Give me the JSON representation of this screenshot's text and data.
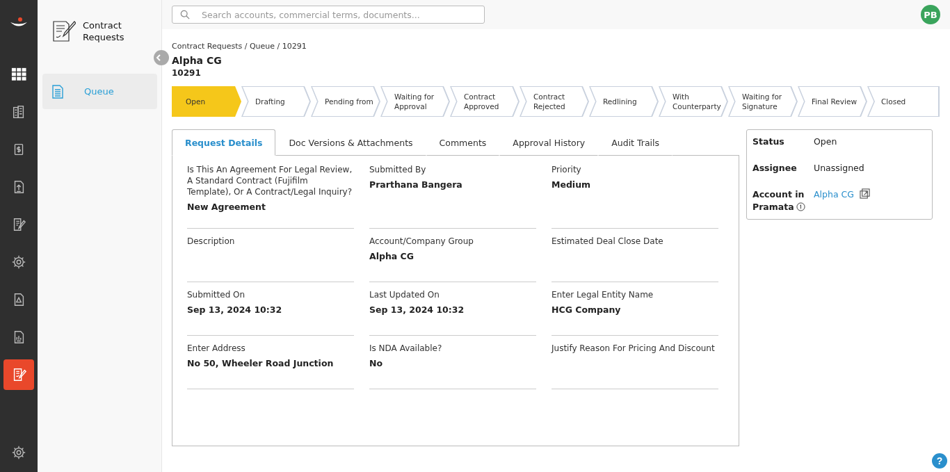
{
  "rail": [
    {
      "selected": false
    },
    {
      "selected": false
    },
    {
      "selected": false
    },
    {
      "selected": false
    },
    {
      "selected": false
    },
    {
      "selected": false
    },
    {
      "selected": false
    },
    {
      "selected": false
    },
    {
      "selected": true
    }
  ],
  "module": {
    "title": "Contract Requests"
  },
  "subnav": [
    {
      "label": "Queue",
      "selected": true
    }
  ],
  "search": {
    "placeholder": "Search accounts, commercial terms, documents..."
  },
  "avatar": "PB",
  "breadcrumb": "Contract Requests / Queue / 10291",
  "title": "Alpha CG",
  "id": "10291",
  "stages": [
    {
      "label": "Open",
      "selected": true
    },
    {
      "label": "Drafting",
      "selected": false
    },
    {
      "label": "Pending from",
      "selected": false
    },
    {
      "label": "Waiting for Approval",
      "selected": false
    },
    {
      "label": "Contract Approved",
      "selected": false
    },
    {
      "label": "Contract Rejected",
      "selected": false
    },
    {
      "label": "Redlining",
      "selected": false
    },
    {
      "label": "With Counterparty",
      "selected": false
    },
    {
      "label": "Waiting for Signature",
      "selected": false
    },
    {
      "label": "Final Review",
      "selected": false
    },
    {
      "label": "Closed",
      "selected": false
    }
  ],
  "tabs": [
    {
      "label": "Request Details",
      "selected": true
    },
    {
      "label": "Doc Versions & Attachments",
      "selected": false
    },
    {
      "label": "Comments",
      "selected": false
    },
    {
      "label": "Approval History",
      "selected": false
    },
    {
      "label": "Audit Trails",
      "selected": false
    }
  ],
  "fields": [
    {
      "label": "Is This An Agreement For Legal Review, A Standard Contract (Fujifilm Template), Or A Contract/Legal Inquiry?",
      "value": "New Agreement"
    },
    {
      "label": "Submitted By",
      "value": "Prarthana Bangera"
    },
    {
      "label": "Priority",
      "value": "Medium"
    },
    {
      "label": "Description"
    },
    {
      "label": "Account/Company Group",
      "value": "Alpha CG"
    },
    {
      "label": "Estimated Deal Close Date"
    },
    {
      "label": "Submitted On",
      "value": "Sep 13, 2024 10:32"
    },
    {
      "label": "Last Updated On",
      "value": "Sep 13, 2024 10:32"
    },
    {
      "label": "Enter Legal Entity Name",
      "value": "HCG Company"
    },
    {
      "label": "Enter Address",
      "value": "No 50, Wheeler Road Junction"
    },
    {
      "label": "Is NDA Available?",
      "value": "No"
    },
    {
      "label": "Justify Reason For Pricing And Discount"
    }
  ],
  "summary": [
    {
      "label": "Status",
      "value": "Open",
      "kind": "text"
    },
    {
      "label": "Assignee",
      "value": "Unassigned",
      "kind": "text"
    },
    {
      "label": "Account in Pramata",
      "value": "Alpha CG",
      "kind": "link"
    }
  ],
  "help": "?"
}
